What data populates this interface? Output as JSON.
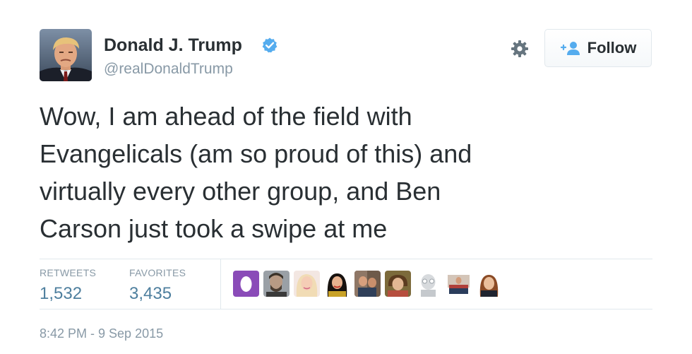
{
  "author": {
    "name": "Donald J. Trump",
    "handle": "@realDonaldTrump",
    "verified": true
  },
  "actions": {
    "follow_label": "Follow",
    "settings_icon": "gear-icon",
    "follow_icon": "add-user-icon"
  },
  "tweet": {
    "text": "Wow, I am ahead of the field with\nEvangelicals (am so proud of this) and\nvirtually every other group, and Ben\nCarson just took a swipe at me"
  },
  "stats": {
    "retweets_label": "RETWEETS",
    "retweets_value": "1,532",
    "favorites_label": "FAVORITES",
    "favorites_value": "3,435"
  },
  "footer": {
    "timestamp": "8:42 PM - 9 Sep 2015"
  },
  "colors": {
    "text": "#292f33",
    "muted": "#8899a6",
    "stat_value": "#4e7f9e",
    "verified": "#55acee",
    "divider": "#e1e8ed"
  }
}
